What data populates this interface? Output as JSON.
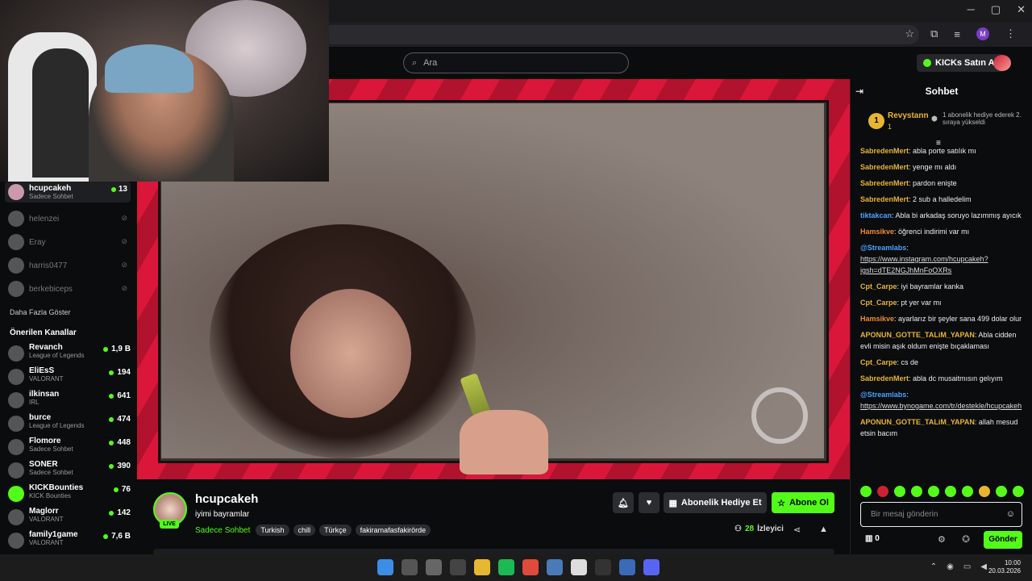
{
  "browser": {
    "win_min": "─",
    "win_max": "▢",
    "win_close": "✕",
    "profile_initial": "M"
  },
  "header": {
    "search_placeholder": "Ara",
    "kicks_label": "KICKs Satın Al"
  },
  "sidebar": {
    "following": [
      {
        "name": "hcupcakeh",
        "sub": "Sadece Sohbet",
        "count": "13",
        "live": true
      },
      {
        "name": "helenzei",
        "live": false
      },
      {
        "name": "Eray",
        "live": false
      },
      {
        "name": "harris0477",
        "live": false
      },
      {
        "name": "berkebiceps",
        "live": false
      }
    ],
    "more_label": "Daha Fazla Göster",
    "recommended_title": "Önerilen Kanallar",
    "recommended": [
      {
        "name": "Revanch",
        "category": "League of Legends",
        "count": "1,9 B"
      },
      {
        "name": "EliEsS",
        "category": "VALORANT",
        "count": "194"
      },
      {
        "name": "ilkinsan",
        "category": "IRL",
        "count": "641"
      },
      {
        "name": "burce",
        "category": "League of Legends",
        "count": "474"
      },
      {
        "name": "Flomore",
        "category": "Sadece Sohbet",
        "count": "448"
      },
      {
        "name": "SONER",
        "category": "Sadece Sohbet",
        "count": "390"
      },
      {
        "name": "KICKBounties",
        "category": "KICK Bounties",
        "count": "76"
      },
      {
        "name": "Maglorr",
        "category": "VALORANT",
        "count": "142"
      },
      {
        "name": "family1game",
        "category": "VALORANT",
        "count": "7,6 B"
      }
    ]
  },
  "stream": {
    "channel": "hcupcakeh",
    "title": "iyimi bayramlar",
    "category": "Sadece Sohbet",
    "tags": [
      "Turkish",
      "chill",
      "Türkçe",
      "fakiramafasfakirörde"
    ],
    "live_label": "LIVE",
    "gift_label": "Abonelik Hediye Et",
    "subscribe_label": "Abone Ol",
    "viewer_count": "28",
    "viewer_label": "İzleyici"
  },
  "chat": {
    "title": "Sohbet",
    "pinned": {
      "rank": "1",
      "name": "Revystann",
      "count": "1",
      "text": "1 abonelik hediye ederek 2. sıraya yükseldi"
    },
    "messages": [
      {
        "user": "SabredenMert",
        "color": "#e8b530",
        "text": "abla porte satılık mı"
      },
      {
        "user": "SabredenMert",
        "color": "#e8b530",
        "text": "yenge mı aldı"
      },
      {
        "user": "SabredenMert",
        "color": "#e8b530",
        "text": "pardon enişte"
      },
      {
        "user": "SabredenMert",
        "color": "#e8b530",
        "text": "2 sub a halledelim"
      },
      {
        "user": "tiktakcan",
        "color": "#4aa3ff",
        "text": "Abla bi arkadaş soruyo lazımmış ayıcık"
      },
      {
        "user": "Hamsikve",
        "color": "#f08a3a",
        "text": "öğrenci indirimi var mı"
      },
      {
        "user": "@Streamlabs",
        "color": "#4aa3ff",
        "text": "",
        "link": "https://www.instagram.com/hcupcakeh?igsh=dTE2NGJhMnFoOXRs"
      },
      {
        "user": "Cpt_Carpe",
        "color": "#e8b530",
        "text": "iyi bayramlar kanka"
      },
      {
        "user": "Cpt_Carpe",
        "color": "#e8b530",
        "text": "pt yer var mı"
      },
      {
        "user": "Hamsikve",
        "color": "#f08a3a",
        "text": "ayarlarız bir şeyler sana 499 dolar olur"
      },
      {
        "user": "APONUN_GOTTE_TALiM_YAPAN",
        "color": "#e8b530",
        "text": "Abla cidden evli misin aşık oldum enişte bıçaklaması"
      },
      {
        "user": "Cpt_Carpe",
        "color": "#e8b530",
        "text": "cs de"
      },
      {
        "user": "SabredenMert",
        "color": "#e8b530",
        "text": "abla dc musaitmısın gelıyım"
      },
      {
        "user": "@Streamlabs",
        "color": "#4aa3ff",
        "text": "",
        "link": "https://www.bynogame.com/tr/destekle/hcupcakeh"
      },
      {
        "user": "APONUN_GOTTE_TALiM_YAPAN",
        "color": "#e8b530",
        "text": "allah mesud etsin bacım"
      }
    ],
    "input_placeholder": "Bir mesaj gönderin",
    "kicks_balance": "0",
    "send_label": "Gönder"
  },
  "taskbar": {
    "time": "10:00",
    "date": "20.03.2026"
  },
  "colors": {
    "accent": "#53fc18",
    "frame_red": "#e3183c",
    "background": "#0b0c0e"
  }
}
